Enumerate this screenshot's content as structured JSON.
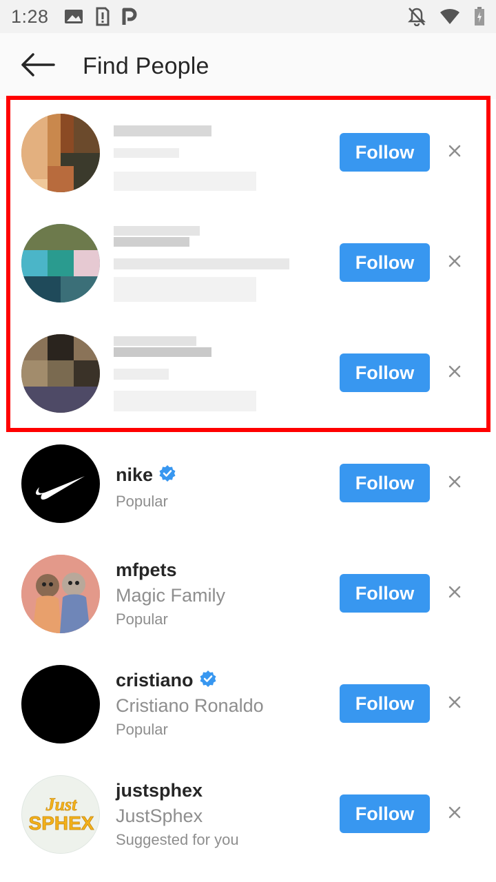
{
  "status_bar": {
    "time": "1:28",
    "left_icons": [
      "image-icon",
      "sim-alert-icon",
      "parking-icon"
    ],
    "right_icons": [
      "notifications-off-icon",
      "wifi-icon",
      "battery-icon"
    ]
  },
  "header": {
    "title": "Find People",
    "back_icon": "arrow-back-icon"
  },
  "colors": {
    "follow_button": "#3897f0",
    "highlight_border": "#ff0000",
    "verified_badge": "#3897f0"
  },
  "blurred_suggestions": [
    {
      "follow_label": "Follow"
    },
    {
      "follow_label": "Follow"
    },
    {
      "follow_label": "Follow"
    }
  ],
  "suggestions": [
    {
      "username": "nike",
      "verified": true,
      "full_name": "",
      "context": "Popular",
      "follow_label": "Follow"
    },
    {
      "username": "mfpets",
      "verified": false,
      "full_name": "Magic Family",
      "context": "Popular",
      "follow_label": "Follow"
    },
    {
      "username": "cristiano",
      "verified": true,
      "full_name": "Cristiano Ronaldo",
      "context": "Popular",
      "follow_label": "Follow"
    },
    {
      "username": "justsphex",
      "verified": false,
      "full_name": "JustSphex",
      "context": "Suggested for you",
      "follow_label": "Follow",
      "avatar_text": "Just SPHEX"
    }
  ]
}
